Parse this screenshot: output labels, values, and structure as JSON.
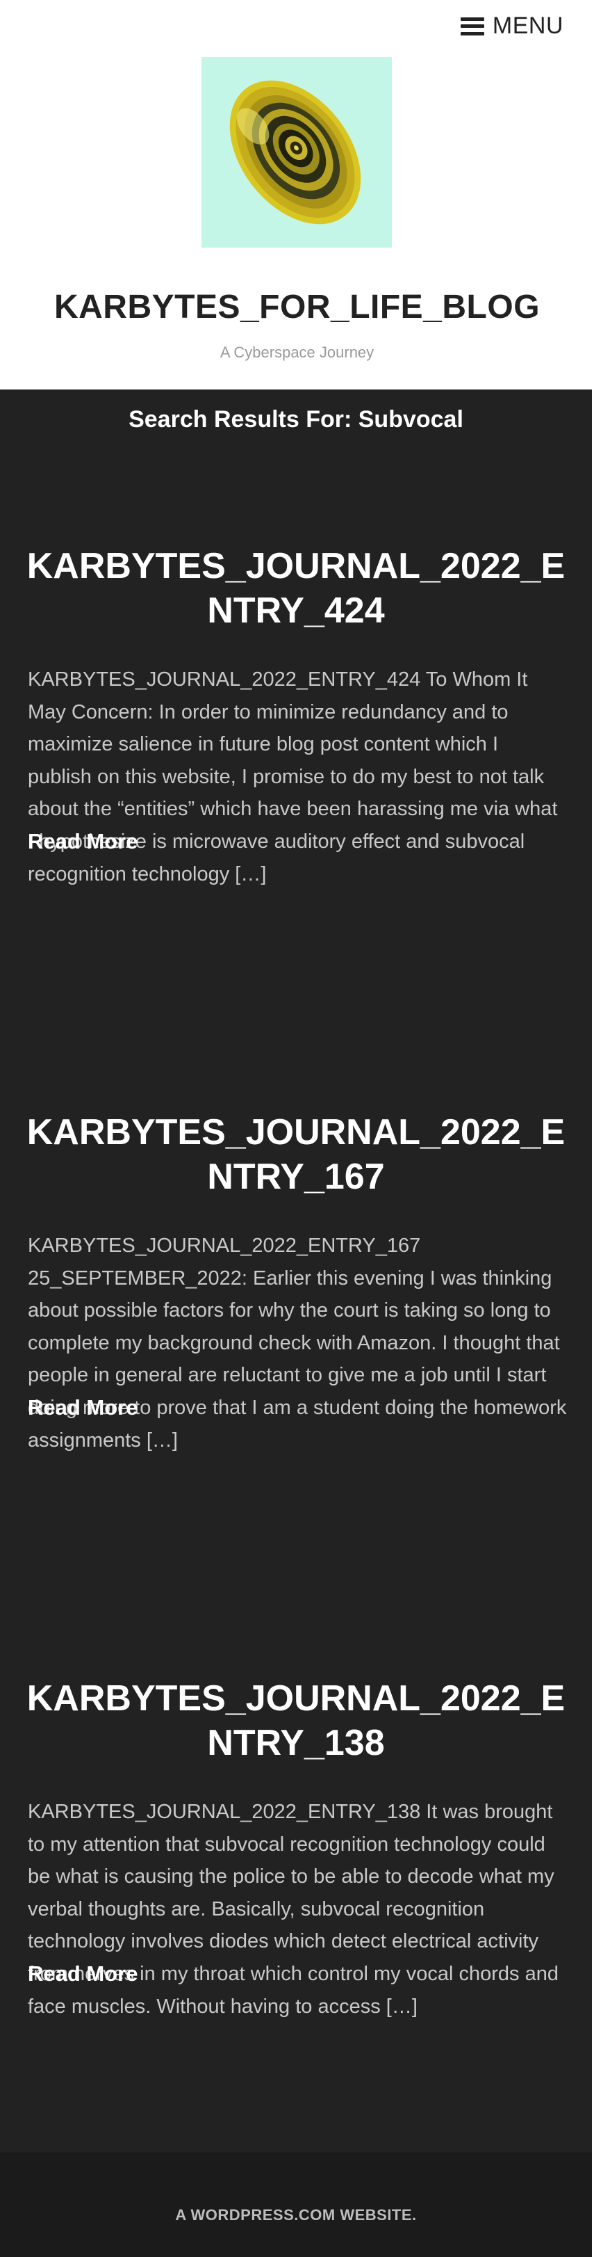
{
  "header": {
    "menu_label": "MENU",
    "site_title": "KARBYTES_FOR_LIFE_BLOG",
    "tagline": "A Cyberspace Journey",
    "logo_icon": "spiral-egg-logo-icon"
  },
  "search": {
    "title": "Search Results For: Subvocal"
  },
  "posts": [
    {
      "title": "KARBYTES_JOURNAL_2022_ENTRY_424",
      "excerpt": "KARBYTES_JOURNAL_2022_ENTRY_424 To Whom It May Concern: In order to minimize redundancy and to maximize salience in future blog post content which I publish on this website, I promise to do my best to not talk about the “entities” which have been harassing me via what I hypothesize is microwave auditory effect and subvocal recognition technology […]",
      "read_more": "Read More"
    },
    {
      "title": "KARBYTES_JOURNAL_2022_ENTRY_167",
      "excerpt": "KARBYTES_JOURNAL_2022_ENTRY_167 25_SEPTEMBER_2022: Earlier this evening I was thinking about possible factors for why the court is taking so long to complete my background check with Amazon. I thought that people in general are reluctant to give me a job until I start doing more to prove that I am a student doing the homework assignments […]",
      "read_more": "Read More"
    },
    {
      "title": "KARBYTES_JOURNAL_2022_ENTRY_138",
      "excerpt": "KARBYTES_JOURNAL_2022_ENTRY_138 It was brought to my attention that subvocal recognition technology could be what is causing the police to be able to decode what my verbal thoughts are. Basically, subvocal recognition technology involves diodes which detect electrical activity from nerves in my throat which control my vocal chords and face muscles. Without having to access […]",
      "read_more": "Read More"
    }
  ],
  "footer": {
    "credit": "A WORDPRESS.COM WEBSITE."
  },
  "colors": {
    "content_bg": "#222222",
    "footer_bg": "#1b1b1b",
    "heading": "#ffffff",
    "excerpt": "#c9c9c9",
    "tagline": "#9a9a9a"
  }
}
